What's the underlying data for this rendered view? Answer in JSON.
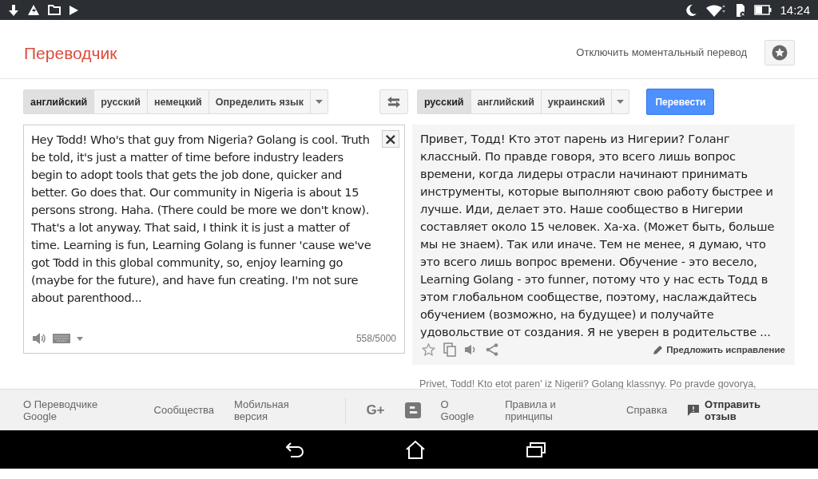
{
  "status_bar": {
    "time": "14:24"
  },
  "header": {
    "title": "Переводчик",
    "instant_toggle": "Отключить моментальный перевод"
  },
  "source_languages": [
    {
      "label": "английский",
      "selected": true
    },
    {
      "label": "русский",
      "selected": false
    },
    {
      "label": "немецкий",
      "selected": false
    },
    {
      "label": "Определить язык",
      "selected": false
    }
  ],
  "target_languages": [
    {
      "label": "русский",
      "selected": true
    },
    {
      "label": "английский",
      "selected": false
    },
    {
      "label": "украинский",
      "selected": false
    }
  ],
  "translate_button": "Перевести",
  "source": {
    "value": "Hey Todd! Who's that guy from Nigeria? Golang is cool. Truth be told, it's just a matter of time before industry leaders begin to adopt tools that gets the job done, quicker and better. Go does that. Our community in Nigeria is about 15 persons strong. Haha. (There could be more we don't know). That's a lot anyway. That said, I think it is just a matter of time. Learning is fun, Learning Golang is funner 'cause we've got Todd in this global community, so, enjoy learning go (maybe for the future), and have fun creating. I'm not sure about parenthood...",
    "close": "×",
    "counter": "558/5000"
  },
  "result": {
    "text": "Привет, Тодд! Кто этот парень из Нигерии? Голанг классный. По правде говоря, это всего лишь вопрос времени, когда лидеры отрасли начинают принимать инструменты, которые выполняют свою работу быстрее и лучше. Иди, делает это. Наше сообщество в Нигерии составляет около 15 человек. Ха-ха. (Может быть, больше мы не знаем). Так или иначе. Тем не менее, я думаю, что это всего лишь вопрос времени. Обучение - это весело, Learning Golang - это funner, потому что у нас есть Тодд в этом глобальном сообществе, поэтому, наслаждайтесь обучением (возможно, на будущее) и получайте удовольствие от создания. Я не уверен в родительстве ...",
    "suggest": "Предложить исправление",
    "transliteration": "Privet, Todd! Kto etot paren' iz Nigerii? Golang klassnyy. Po pravde govorya,"
  },
  "footer": {
    "links_left": [
      "О Переводчике Google",
      "Сообщества",
      "Мобильная версия"
    ],
    "gplus": "G+",
    "links_right": [
      "О Google",
      "Правила и принципы",
      "Справка"
    ],
    "feedback": "Отправить отзыв"
  }
}
